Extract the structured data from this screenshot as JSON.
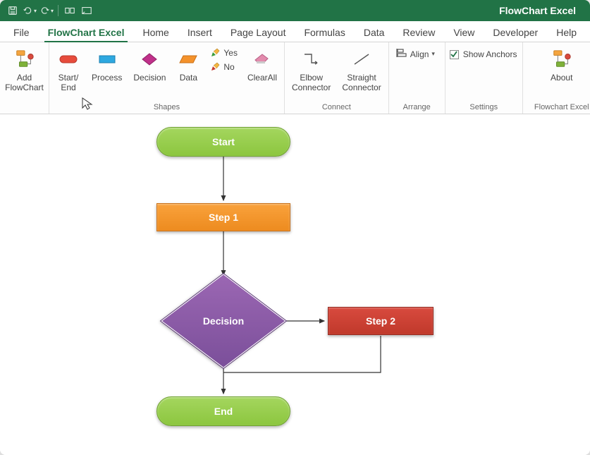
{
  "app_title": "FlowChart Excel",
  "qat": {
    "save": "save-icon",
    "undo": "undo-icon",
    "redo": "redo-icon",
    "touch": "touch-icon",
    "fullscreen": "fullscreen-icon"
  },
  "tabs": [
    {
      "label": "File"
    },
    {
      "label": "FlowChart Excel",
      "active": true
    },
    {
      "label": "Home"
    },
    {
      "label": "Insert"
    },
    {
      "label": "Page Layout"
    },
    {
      "label": "Formulas"
    },
    {
      "label": "Data"
    },
    {
      "label": "Review"
    },
    {
      "label": "View"
    },
    {
      "label": "Developer"
    },
    {
      "label": "Help"
    }
  ],
  "ribbon": {
    "add_flowchart": "Add\nFlowChart",
    "shapes": {
      "start_end": "Start/\nEnd",
      "process": "Process",
      "decision": "Decision",
      "data": "Data",
      "yes": "Yes",
      "no": "No",
      "clear_all": "ClearAll",
      "group_label": "Shapes"
    },
    "connect": {
      "elbow": "Elbow\nConnector",
      "straight": "Straight\nConnector",
      "group_label": "Connect"
    },
    "arrange": {
      "align": "Align",
      "group_label": "Arrange"
    },
    "settings": {
      "show_anchors": "Show Anchors",
      "group_label": "Settings"
    },
    "about": {
      "about": "About",
      "group_label": "Flowchart Excel"
    }
  },
  "canvas": {
    "start": "Start",
    "step1": "Step 1",
    "decision": "Decision",
    "step2": "Step 2",
    "end": "End"
  }
}
